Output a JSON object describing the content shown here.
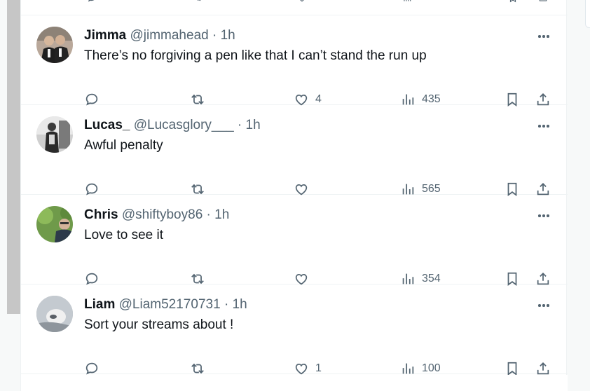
{
  "feed": {
    "tweets": [
      {
        "name": "Jimma",
        "handle": "@jimmahead",
        "separator": "·",
        "time": "1h",
        "text": "There’s no forgiving a pen like that I can’t stand the run up",
        "likes": "4",
        "views": "435"
      },
      {
        "name": "Lucas_",
        "handle": "@Lucasglory___",
        "separator": "·",
        "time": "1h",
        "text": "Awful penalty",
        "likes": "",
        "views": "565"
      },
      {
        "name": "Chris",
        "handle": "@shiftyboy86",
        "separator": "·",
        "time": "1h",
        "text": "Love to see it",
        "likes": "",
        "views": "354"
      },
      {
        "name": "Liam",
        "handle": "@Liam52170731",
        "separator": "·",
        "time": "1h",
        "text": "Sort your streams about !",
        "likes": "1",
        "views": "100"
      }
    ]
  },
  "colors": {
    "text_primary": "#0f1419",
    "text_secondary": "#536471",
    "divider": "#eff3f4",
    "scrollbar": "#c6c6c6"
  },
  "icons": [
    "reply-icon",
    "retweet-icon",
    "like-icon",
    "views-icon",
    "bookmark-icon",
    "share-icon",
    "more-icon"
  ]
}
